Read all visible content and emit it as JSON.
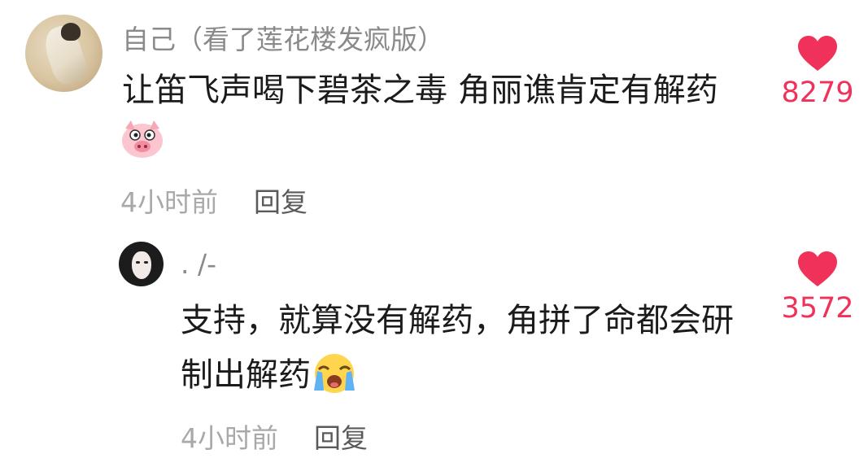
{
  "colors": {
    "like": "#f0325a",
    "username": "#8a8a8a",
    "content": "#1b1b1b",
    "timestamp": "#a9a9a9",
    "reply": "#5a5a5a"
  },
  "comments": [
    {
      "username": "自己（看了莲花楼发疯版）",
      "text_line1": "让笛飞声喝下碧茶之毒 角丽谯肯定有解药",
      "emoji": "pig-face-emoji",
      "time": "4小时前",
      "reply_label": "回复",
      "likes": "8279",
      "like_icon": "heart-icon"
    },
    {
      "username": ". /-",
      "text_line1": "支持，就算没有解药，角拼了命都会研",
      "text_line2": "制出解药",
      "emoji": "loudly-crying-emoji",
      "time": "4小时前",
      "reply_label": "回复",
      "likes": "3572",
      "like_icon": "heart-icon"
    }
  ]
}
